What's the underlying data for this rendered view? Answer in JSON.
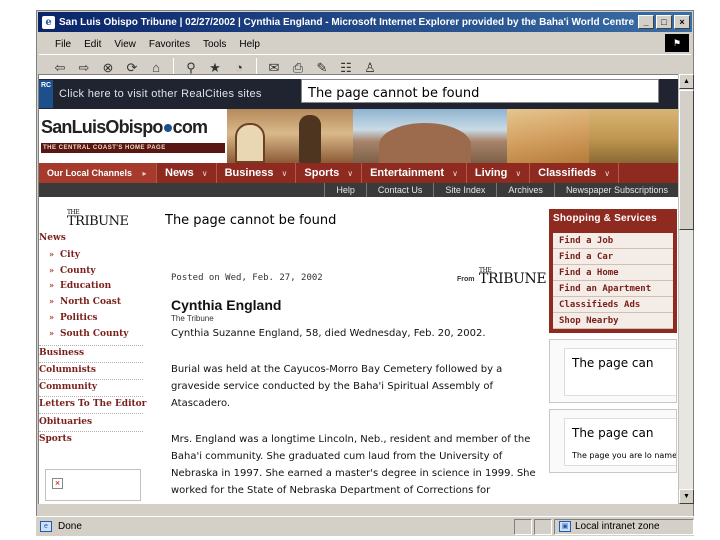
{
  "window": {
    "title": "San Luis Obispo Tribune | 02/27/2002 | Cynthia England - Microsoft Internet Explorer provided by the Baha'i World Centre",
    "controls": [
      "_",
      "□",
      "×"
    ]
  },
  "menu": [
    "File",
    "Edit",
    "View",
    "Favorites",
    "Tools",
    "Help"
  ],
  "toolbar": {
    "icons": [
      "back-icon",
      "forward-icon",
      "stop-icon",
      "refresh-icon",
      "home-icon",
      "search-icon",
      "favorites-icon",
      "history-icon",
      "mail-icon",
      "print-icon",
      "edit-icon",
      "discuss-icon",
      "messenger-icon"
    ]
  },
  "realcities": {
    "logo": "RC",
    "banner_text": "Click here to visit other RealCities sites",
    "error_text": "The page cannot be found"
  },
  "masthead": {
    "brand_left": "SanLuisObispo",
    "brand_right": "com",
    "tagline": "THE CENTRAL COAST'S HOME PAGE"
  },
  "nav": {
    "channels_label": "Our Local Channels",
    "items": [
      "News",
      "Business",
      "Sports",
      "Entertainment",
      "Living",
      "Classifieds"
    ]
  },
  "subnav": [
    "Help",
    "Contact Us",
    "Site Index",
    "Archives",
    "Newspaper Subscriptions"
  ],
  "sidebar": {
    "logo_the": "THE",
    "logo_name": "TRIBUNE",
    "news_label": "News",
    "news_sub": [
      "City",
      "County",
      "Education",
      "North Coast",
      "Politics",
      "South County"
    ],
    "sections": [
      "Business",
      "Columnists",
      "Community",
      "Letters To The Editor",
      "Obituaries",
      "Sports"
    ]
  },
  "article": {
    "page_error_heading": "The page cannot be found",
    "dateline": "Posted on Wed, Feb. 27, 2002",
    "from_label": "From",
    "source_the": "THE",
    "source_name": "TRIBUNE",
    "title": "Cynthia England",
    "byline": "The Tribune",
    "paragraphs": [
      "Cynthia Suzanne England, 58, died Wednesday, Feb. 20, 2002.",
      "Burial was held at the Cayucos-Morro Bay Cemetery followed by a graveside service conducted by the Baha'i Spiritual Assembly of Atascadero.",
      "Mrs. England was a longtime Lincoln, Neb., resident and member of the Baha'i community. She graduated cum laud from the University of Nebraska in 1997. She earned a master's degree in science in 1999. She worked for the State of Nebraska Department of Corrections for"
    ]
  },
  "shopping": {
    "title": "Shopping & Services",
    "items": [
      "Find a Job",
      "Find a Car",
      "Find a Home",
      "Find an Apartment",
      "Classifieds Ads",
      "Shop Nearby"
    ]
  },
  "ads": [
    {
      "error_text": "The page can"
    },
    {
      "error_text": "The page can",
      "detail": "The page you are lo name changed, or i"
    }
  ],
  "status": {
    "left_text": "Done",
    "zone_text": "Local intranet zone"
  }
}
